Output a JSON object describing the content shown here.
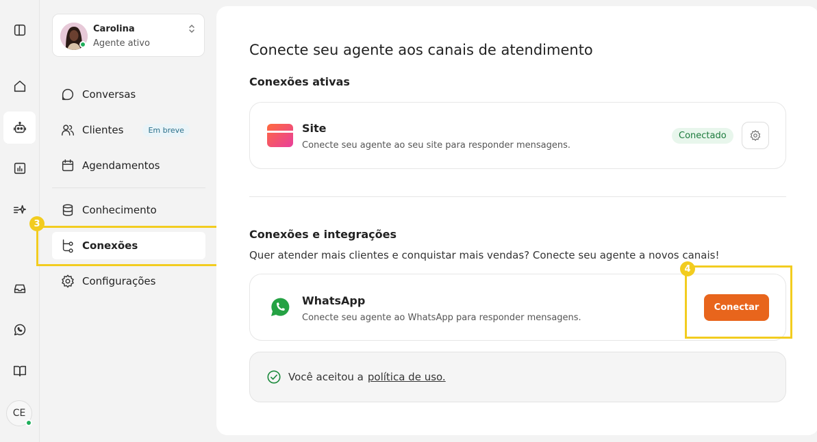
{
  "rail": {
    "items": [
      {
        "icon": "sidebar-toggle-icon"
      },
      {
        "icon": "home-icon"
      },
      {
        "icon": "bot-icon"
      },
      {
        "icon": "analytics-icon"
      },
      {
        "icon": "sparkle-icon"
      },
      {
        "icon": "inbox-icon"
      },
      {
        "icon": "whatsapp-icon"
      },
      {
        "icon": "book-icon"
      }
    ],
    "user_initials": "CE"
  },
  "profile": {
    "name": "Carolina",
    "status": "Agente ativo"
  },
  "nav": {
    "items": [
      {
        "label": "Conversas",
        "icon": "chat-icon"
      },
      {
        "label": "Clientes",
        "icon": "users-icon",
        "badge": "Em breve"
      },
      {
        "label": "Agendamentos",
        "icon": "calendar-icon"
      },
      {
        "label": "Conhecimento",
        "icon": "database-icon"
      },
      {
        "label": "Conexões",
        "icon": "connections-icon"
      },
      {
        "label": "Configurações",
        "icon": "gear-icon"
      }
    ]
  },
  "steps": {
    "three": "3",
    "four": "4"
  },
  "main": {
    "title": "Conecte seu agente aos canais de atendimento",
    "active_heading": "Conexões ativas",
    "site": {
      "title": "Site",
      "description": "Conecte seu agente ao seu site para responder mensagens.",
      "status": "Conectado"
    },
    "integrations_heading": "Conexões e integrações",
    "integrations_sub": "Quer atender mais clientes e conquistar mais vendas? Conecte seu agente a novos canais!",
    "whatsapp": {
      "title": "WhatsApp",
      "description": "Conecte seu agente ao WhatsApp para responder mensagens.",
      "button": "Conectar"
    },
    "terms": {
      "text": "Você aceitou a",
      "link": "política de uso."
    }
  },
  "colors": {
    "accent_orange": "#e8651c",
    "highlight_yellow": "#f2cc1f",
    "status_green": "#1b7a3c"
  }
}
